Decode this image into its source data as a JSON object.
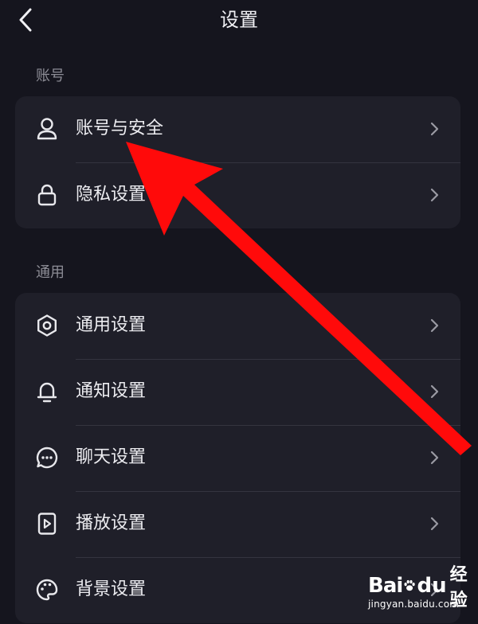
{
  "header": {
    "title": "设置",
    "back_icon": "chevron-left-icon"
  },
  "sections": [
    {
      "label": "账号",
      "items": [
        {
          "label": "账号与安全",
          "icon": "user-icon"
        },
        {
          "label": "隐私设置",
          "icon": "lock-icon"
        }
      ]
    },
    {
      "label": "通用",
      "items": [
        {
          "label": "通用设置",
          "icon": "gear-icon"
        },
        {
          "label": "通知设置",
          "icon": "bell-icon"
        },
        {
          "label": "聊天设置",
          "icon": "chat-bubble-icon"
        },
        {
          "label": "播放设置",
          "icon": "play-icon"
        },
        {
          "label": "背景设置",
          "icon": "palette-icon"
        }
      ]
    }
  ],
  "annotation": {
    "arrow_color": "#ff0a0a"
  },
  "watermark": {
    "brand_left": "Bai",
    "brand_right": "du",
    "brand_suffix": "经验",
    "url": "jingyan.baidu.com"
  },
  "colors": {
    "background": "#15151e",
    "card": "#1f1f29",
    "text": "#ececf0",
    "muted": "#8d8d96"
  }
}
